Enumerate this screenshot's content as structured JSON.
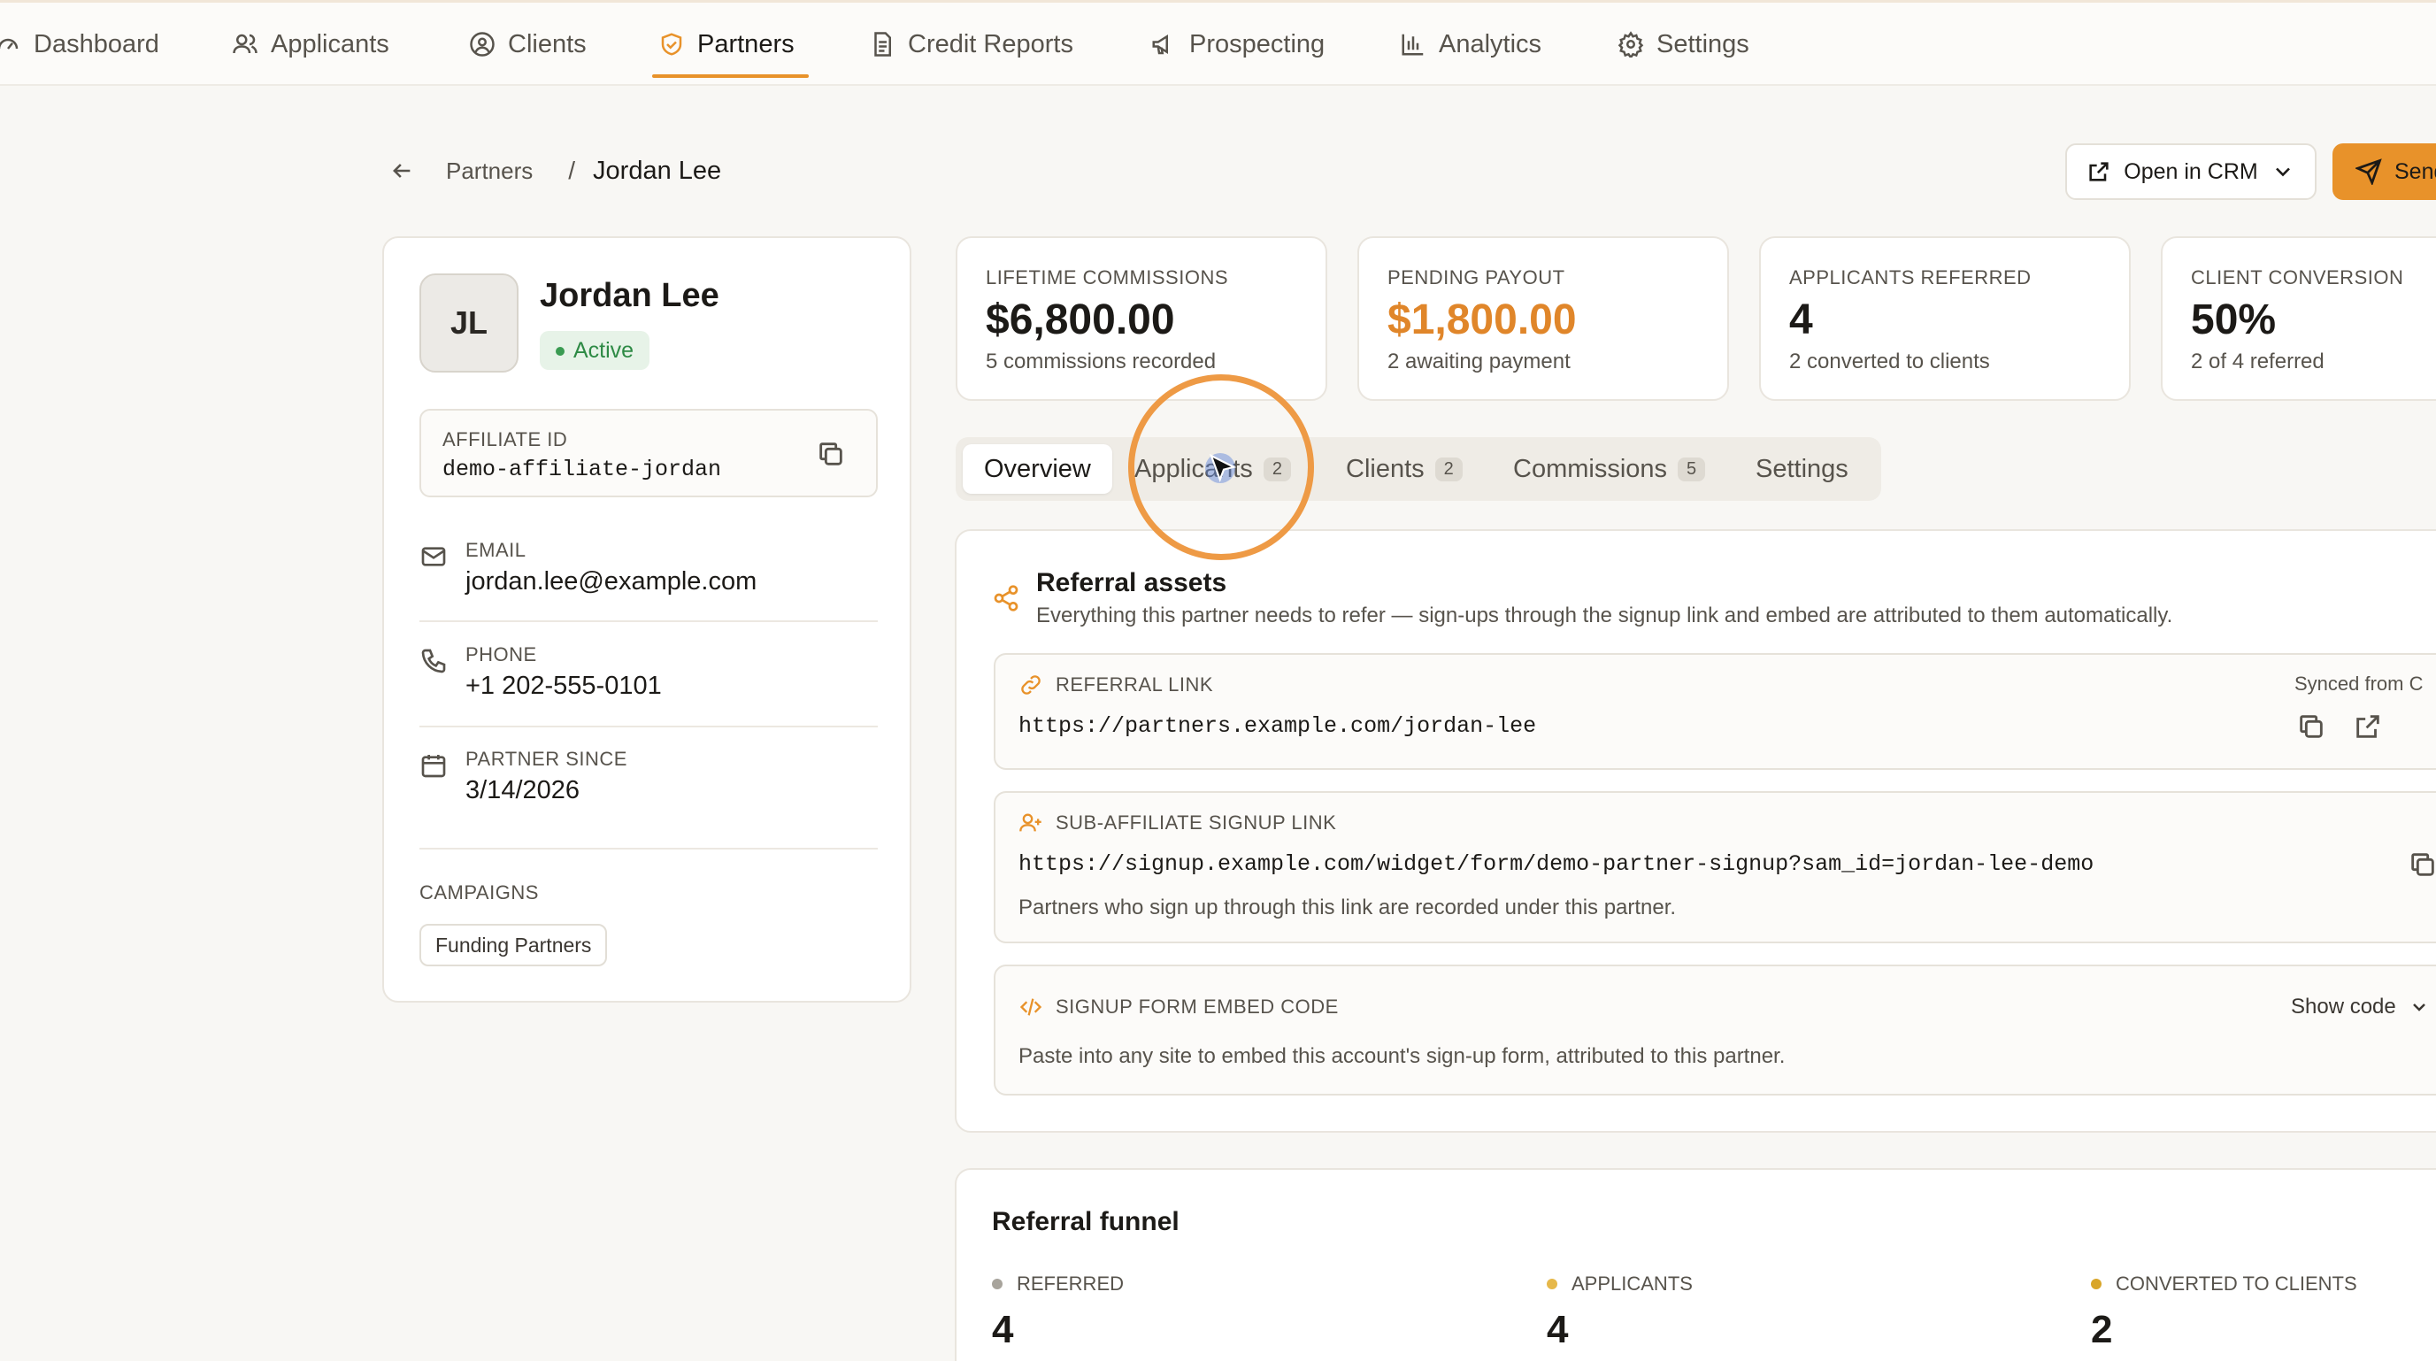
{
  "nav": {
    "items": [
      {
        "label": "Dashboard",
        "icon": "gauge-icon"
      },
      {
        "label": "Applicants",
        "icon": "users-icon"
      },
      {
        "label": "Clients",
        "icon": "user-circle-icon"
      },
      {
        "label": "Partners",
        "icon": "handshake-shield-icon",
        "active": true
      },
      {
        "label": "Credit Reports",
        "icon": "document-icon"
      },
      {
        "label": "Prospecting",
        "icon": "megaphone-icon"
      },
      {
        "label": "Analytics",
        "icon": "bar-chart-icon"
      },
      {
        "label": "Settings",
        "icon": "gear-icon"
      }
    ],
    "accent_color": "#e8922a"
  },
  "breadcrumb": {
    "parent": "Partners",
    "separator": "/",
    "current": "Jordan Lee"
  },
  "actions": {
    "open_crm": "Open in CRM",
    "send": "Send"
  },
  "profile": {
    "initials": "JL",
    "name": "Jordan Lee",
    "status": "Active",
    "affiliate_id_label": "AFFILIATE ID",
    "affiliate_id": "demo-affiliate-jordan",
    "email_label": "EMAIL",
    "email": "jordan.lee@example.com",
    "phone_label": "PHONE",
    "phone": "+1 202-555-0101",
    "since_label": "PARTNER SINCE",
    "since": "3/14/2026",
    "campaigns_label": "CAMPAIGNS",
    "campaigns": [
      "Funding Partners"
    ]
  },
  "stats": [
    {
      "label": "LIFETIME COMMISSIONS",
      "value": "$6,800.00",
      "sub": "5 commissions recorded",
      "color": "#1c1a17"
    },
    {
      "label": "PENDING PAYOUT",
      "value": "$1,800.00",
      "sub": "2 awaiting payment",
      "color": "#e0862a"
    },
    {
      "label": "APPLICANTS REFERRED",
      "value": "4",
      "sub": "2 converted to clients",
      "color": "#1c1a17"
    },
    {
      "label": "CLIENT CONVERSION",
      "value": "50%",
      "sub": "2 of 4 referred",
      "color": "#1c1a17"
    }
  ],
  "tabs": [
    {
      "label": "Overview",
      "active": true
    },
    {
      "label": "Applicants",
      "count": "2"
    },
    {
      "label": "Clients",
      "count": "2"
    },
    {
      "label": "Commissions",
      "count": "5"
    },
    {
      "label": "Settings"
    }
  ],
  "referral_assets": {
    "title": "Referral assets",
    "description": "Everything this partner needs to refer — sign-ups through the signup link and embed are attributed to them automatically.",
    "referral_link": {
      "label": "REFERRAL LINK",
      "value": "https://partners.example.com/jordan-lee",
      "synced": "Synced from C"
    },
    "sub_affiliate": {
      "label": "SUB-AFFILIATE SIGNUP LINK",
      "value": "https://signup.example.com/widget/form/demo-partner-signup?sam_id=jordan-lee-demo",
      "note": "Partners who sign up through this link are recorded under this partner."
    },
    "embed": {
      "label": "SIGNUP FORM EMBED CODE",
      "toggle": "Show code",
      "note": "Paste into any site to embed this account's sign-up form, attributed to this partner."
    }
  },
  "funnel": {
    "title": "Referral funnel",
    "stages": [
      {
        "label": "REFERRED",
        "value": "4",
        "color": "#a8a49c"
      },
      {
        "label": "APPLICANTS",
        "value": "4",
        "color": "#e6b84a"
      },
      {
        "label": "CONVERTED TO CLIENTS",
        "value": "2",
        "color": "#d9a62a"
      }
    ]
  }
}
